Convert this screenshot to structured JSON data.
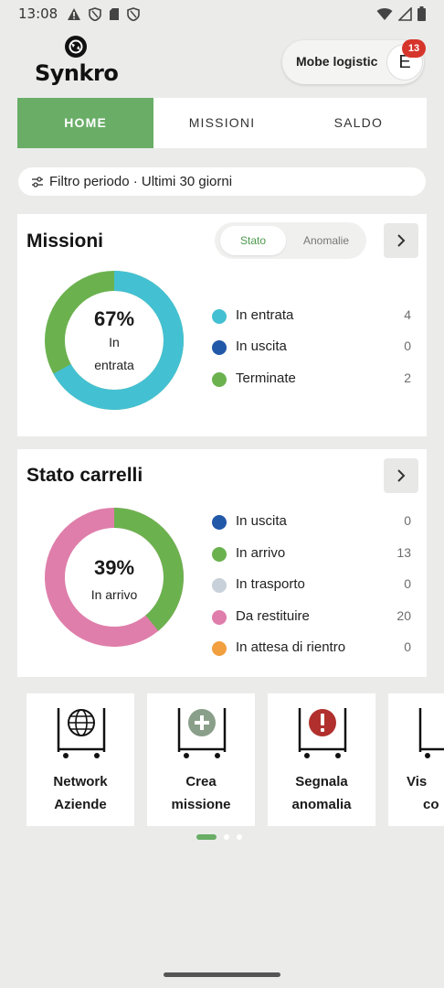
{
  "statusbar": {
    "time": "13:08"
  },
  "app": {
    "logo_text": "Synkro"
  },
  "account": {
    "name": "Mobe logistic",
    "initial": "E",
    "badge": "13"
  },
  "tabs": [
    {
      "label": "HOME",
      "active": true
    },
    {
      "label": "MISSIONI",
      "active": false
    },
    {
      "label": "SALDO",
      "active": false
    }
  ],
  "filter": {
    "label": "Filtro periodo · Ultimi 30 giorni"
  },
  "missioni": {
    "title": "Missioni",
    "segments": [
      "Stato",
      "Anomalie"
    ],
    "donut": {
      "percent": "67%",
      "line1": "In",
      "line2": "entrata"
    },
    "legend": [
      {
        "label": "In entrata",
        "value": "4",
        "color": "#44c0d3"
      },
      {
        "label": "In uscita",
        "value": "0",
        "color": "#2258a8"
      },
      {
        "label": "Terminate",
        "value": "2",
        "color": "#6bb24f"
      }
    ]
  },
  "carrelli": {
    "title": "Stato carrelli",
    "donut": {
      "percent": "39%",
      "line1": "In arrivo"
    },
    "legend": [
      {
        "label": "In uscita",
        "value": "0",
        "color": "#2258a8"
      },
      {
        "label": "In arrivo",
        "value": "13",
        "color": "#6bb24f"
      },
      {
        "label": "In trasporto",
        "value": "0",
        "color": "#c8d1d9"
      },
      {
        "label": "Da restituire",
        "value": "20",
        "color": "#df7eab"
      },
      {
        "label": "In attesa di rientro",
        "value": "0",
        "color": "#f29f40"
      }
    ]
  },
  "actions": [
    {
      "line1": "Network",
      "line2": "Aziende",
      "icon": "globe-cart-icon"
    },
    {
      "line1": "Crea",
      "line2": "missione",
      "icon": "add-cart-icon"
    },
    {
      "line1": "Segnala",
      "line2": "anomalia",
      "icon": "alert-cart-icon"
    },
    {
      "line1": "Vis",
      "line2": "co",
      "icon": "cart-icon"
    }
  ],
  "colors": {
    "accent": "#69ad67",
    "danger": "#d6352b"
  }
}
